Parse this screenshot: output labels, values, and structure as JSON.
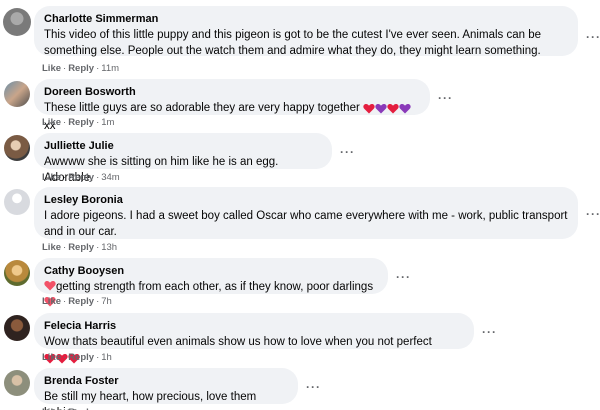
{
  "actions": {
    "like": "Like",
    "reply": "Reply",
    "separator": "·"
  },
  "more_label": "···",
  "comments": [
    {
      "name": "Charlotte Simmerman",
      "lines": [
        "This video of this little puppy and this pigeon is got to be the cutest I've ever seen. Animals can be",
        "something else. People out the watch them and admire what they do, they might learn something."
      ],
      "time": "11m"
    },
    {
      "name": "Doreen Bosworth",
      "lines": [
        "These little guys are so adorable they are very happy together"
      ],
      "suffix": "xx",
      "time": "1m"
    },
    {
      "name": "Julliette Julie",
      "lines": [
        "Awwww she is sitting on him like he is an egg. Adorable."
      ],
      "time": "34m"
    },
    {
      "name": "Lesley Boronia",
      "lines": [
        "I adore pigeons. I had a sweet boy called Oscar who came everywhere with me - work, public transport",
        "and in our car."
      ],
      "time": "13h"
    },
    {
      "name": "Cathy Booysen",
      "lines": [
        "getting strength from each other, as if they know, poor darlings"
      ],
      "time": "7h"
    },
    {
      "name": "Felecia Harris",
      "lines": [
        "Wow thats beautiful even animals show us how to love when you not perfect"
      ],
      "time": "1h"
    },
    {
      "name": "Brenda Foster",
      "lines": [
        "Be still my heart, how precious, love them babies."
      ],
      "time": ""
    }
  ],
  "colors": {
    "bubble": "#f0f2f5",
    "meta": "#65676b",
    "heart_red": "#e41e3f",
    "heart_purple": "#8a3ab9",
    "heart_pink": "#f25268"
  }
}
